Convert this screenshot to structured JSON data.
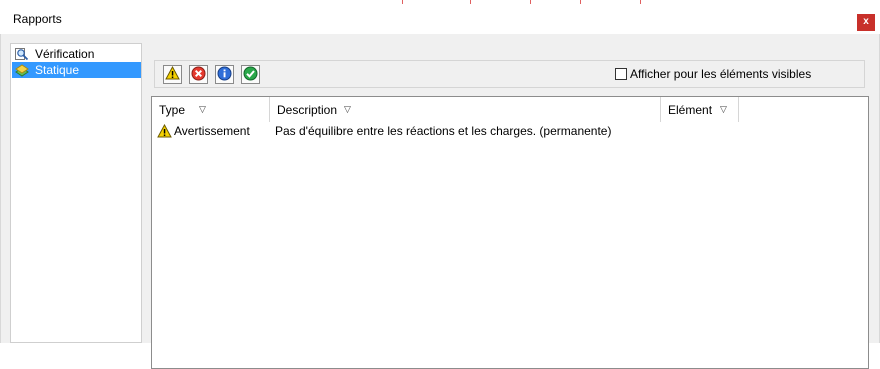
{
  "window": {
    "title": "Rapports",
    "close_label": "x"
  },
  "tree": {
    "items": [
      {
        "label": "Vérification",
        "icon": "magnifier-check-icon",
        "selected": false
      },
      {
        "label": "Statique",
        "icon": "static-analysis-icon",
        "selected": true
      }
    ]
  },
  "toolbar": {
    "buttons": [
      {
        "icon": "warning-icon"
      },
      {
        "icon": "error-icon"
      },
      {
        "icon": "info-icon"
      },
      {
        "icon": "ok-check-icon"
      }
    ],
    "checkbox_label": "Afficher pour les éléments visibles",
    "checkbox_checked": false
  },
  "grid": {
    "columns": [
      {
        "label": "Type"
      },
      {
        "label": "Description"
      },
      {
        "label": "Elément"
      }
    ],
    "filter_glyph": "▽",
    "rows": [
      {
        "type_icon": "warning-icon",
        "type": "Avertissement",
        "description": "Pas d'équilibre entre les réactions et les charges. (permanente)",
        "element": ""
      }
    ]
  },
  "colors": {
    "selection": "#3399ff",
    "close_button": "#c8302a",
    "warning": "#f5d100",
    "error": "#e53a2f",
    "info": "#2f6ed8",
    "ok": "#2aa84a"
  }
}
